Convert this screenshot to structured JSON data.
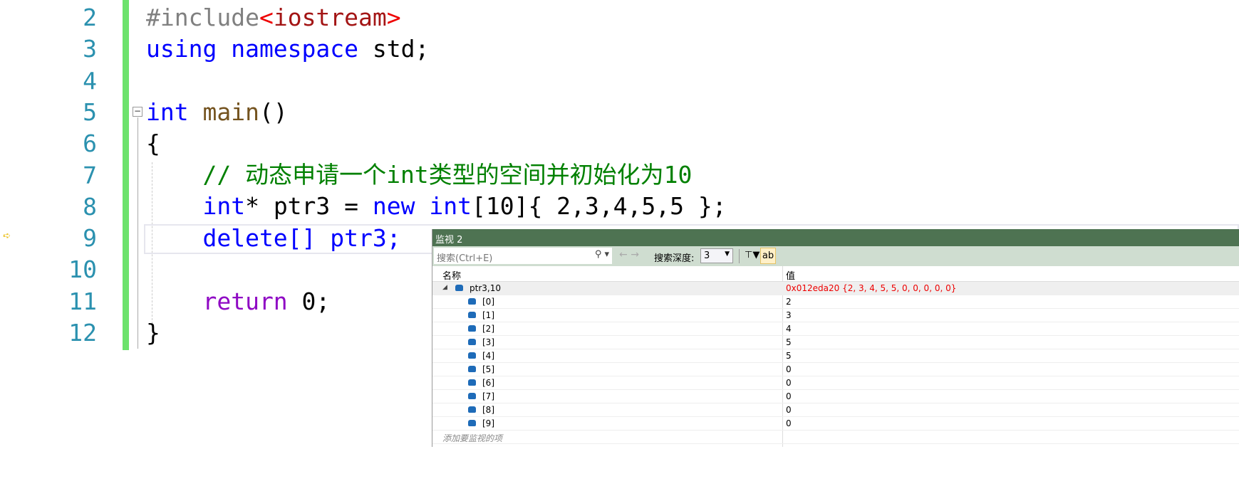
{
  "editor": {
    "line_numbers": [
      "2",
      "3",
      "4",
      "5",
      "6",
      "7",
      "8",
      "9",
      "10",
      "11",
      "12"
    ],
    "lines": {
      "l2a": "#include",
      "l2b": "<",
      "l2c": "iostream",
      "l2d": ">",
      "l3a": "using namespace",
      "l3b": " std;",
      "l5a": "int",
      "l5b": " main",
      "l5c": "()",
      "l6": "{",
      "l7": "    // 动态申请一个int类型的空间并初始化为10",
      "l8a": "    int",
      "l8b": "* ptr3 = ",
      "l8c": "new int",
      "l8d": "[10]{ 2,3,4,5,5 };",
      "l9a": "    delete",
      "l9b": "[] ptr3;",
      "l11a": "    return",
      "l11b": " 0;",
      "l12": "}"
    }
  },
  "watch": {
    "title": "监视 2",
    "search_placeholder": "搜索(Ctrl+E)",
    "depth_label": "搜索深度:",
    "depth_value": "3",
    "col_name": "名称",
    "col_value": "值",
    "root": {
      "name": "ptr3,10",
      "value": "0x012eda20 {2, 3, 4, 5, 5, 0, 0, 0, 0, 0}"
    },
    "items": [
      {
        "name": "[0]",
        "value": "2"
      },
      {
        "name": "[1]",
        "value": "3"
      },
      {
        "name": "[2]",
        "value": "4"
      },
      {
        "name": "[3]",
        "value": "5"
      },
      {
        "name": "[4]",
        "value": "5"
      },
      {
        "name": "[5]",
        "value": "0"
      },
      {
        "name": "[6]",
        "value": "0"
      },
      {
        "name": "[7]",
        "value": "0"
      },
      {
        "name": "[8]",
        "value": "0"
      },
      {
        "name": "[9]",
        "value": "0"
      }
    ],
    "add_item": "添加要监视的项"
  },
  "colors": {
    "watch_title": "#4e7352",
    "toolbar": "#cfddd0",
    "keyword": "#0000ff",
    "comment": "#008000",
    "error_value": "#e00000"
  }
}
